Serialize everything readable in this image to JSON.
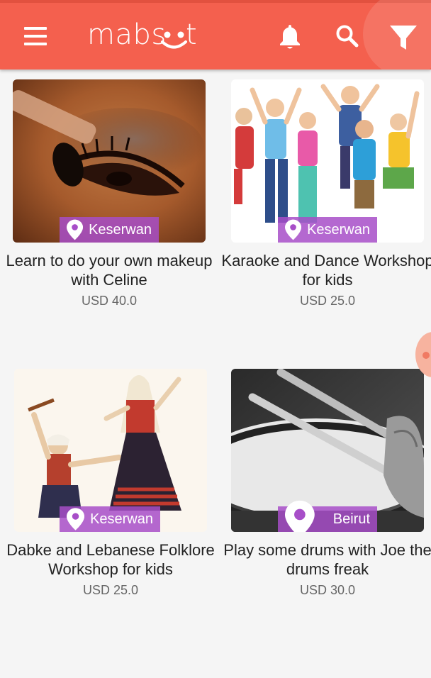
{
  "app": {
    "logo_text": "mabsoot",
    "accent_color": "#f4604e",
    "location_badge_color": "#a74ec8",
    "icons": [
      "menu-icon",
      "bell-icon",
      "search-icon",
      "filter-icon"
    ]
  },
  "cards": [
    {
      "title": "Learn to do your own makeup with Celine",
      "price": "USD 40.0",
      "location": "Keserwan",
      "image": "makeup-eye-photo"
    },
    {
      "title": "Karaoke and Dance Workshop for kids",
      "price": "USD 25.0",
      "location": "Keserwan",
      "image": "jumping-kids-photo"
    },
    {
      "title": "Dabke and Lebanese Folklore Workshop for kids",
      "price": "USD 25.0",
      "location": "Keserwan",
      "image": "folklore-dancers-illustration"
    },
    {
      "title": "Play some drums with Joe the drums freak",
      "price": "USD 30.0",
      "location": "Beirut",
      "image": "drum-sticks-photo"
    }
  ]
}
